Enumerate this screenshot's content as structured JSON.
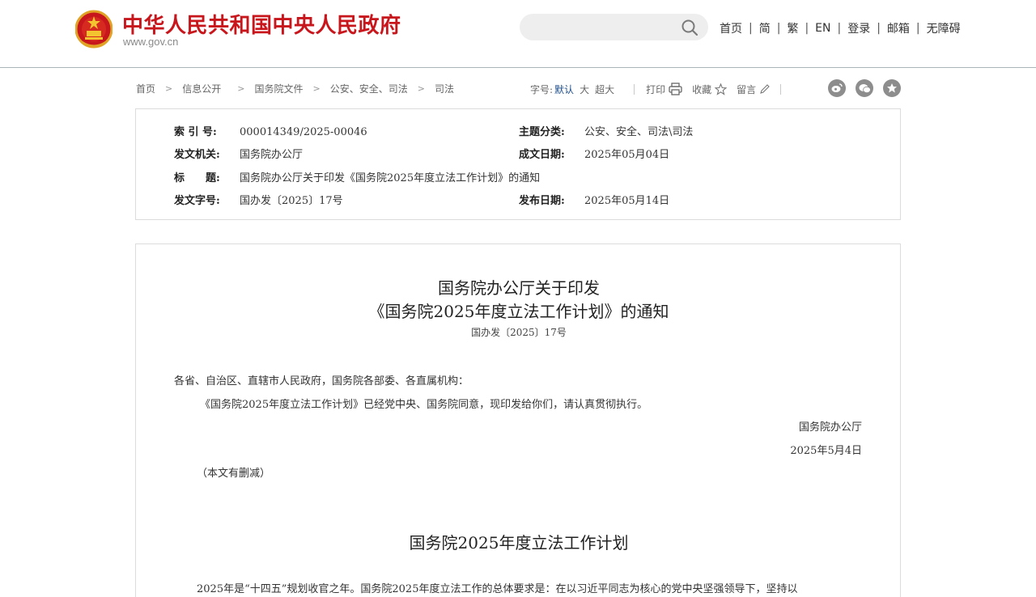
{
  "header": {
    "site_title": "中华人民共和国中央人民政府",
    "site_url": "www.gov.cn",
    "search": {
      "placeholder": "",
      "value": ""
    },
    "nav": [
      "首页",
      "简",
      "繁",
      "EN",
      "登录",
      "邮箱",
      "无障碍"
    ],
    "nav_separator": "|",
    "brand_color": "#c8161d"
  },
  "breadcrumb": [
    "首页",
    "信息公开",
    "国务院文件",
    "公安、安全、司法",
    "司法"
  ],
  "breadcrumb_separator": ">",
  "toolbar": {
    "font_size_label": "字号:",
    "font_sizes": [
      "默认",
      "大",
      "超大"
    ],
    "active_font_size": "默认",
    "print": "打印",
    "favorite": "收藏",
    "comment": "留言",
    "share_icons": [
      "weibo-icon",
      "wechat-icon",
      "favorite-star-icon"
    ]
  },
  "metadata": {
    "index_label": "索 引 号:",
    "index_value": "000014349/2025-00046",
    "category_label": "主题分类:",
    "category_value": "公安、安全、司法\\司法",
    "issuer_label": "发文机关:",
    "issuer_value": "国务院办公厅",
    "written_label": "成文日期:",
    "written_value": "2025年05月04日",
    "title_label": "标　　题:",
    "title_value": "国务院办公厅关于印发《国务院2025年度立法工作计划》的通知",
    "docno_label": "发文字号:",
    "docno_value": "国办发〔2025〕17号",
    "publish_label": "发布日期:",
    "publish_value": "2025年05月14日"
  },
  "article": {
    "title_line1": "国务院办公厅关于印发",
    "title_line2": "《国务院2025年度立法工作计划》的通知",
    "doc_number": "国办发〔2025〕17号",
    "recipients": "各省、自治区、直辖市人民政府，国务院各部委、各直属机构：",
    "body": "《国务院2025年度立法工作计划》已经党中央、国务院同意，现印发给你们，请认真贯彻执行。",
    "signature": "国务院办公厅",
    "date": "2025年5月4日",
    "note": "（本文有删减）",
    "plan_title": "国务院2025年度立法工作计划",
    "plan_first_line": "2025年是“十四五”规划收官之年。国务院2025年度立法工作的总体要求是：在以习近平同志为核心的党中央坚强领导下，坚持以"
  }
}
